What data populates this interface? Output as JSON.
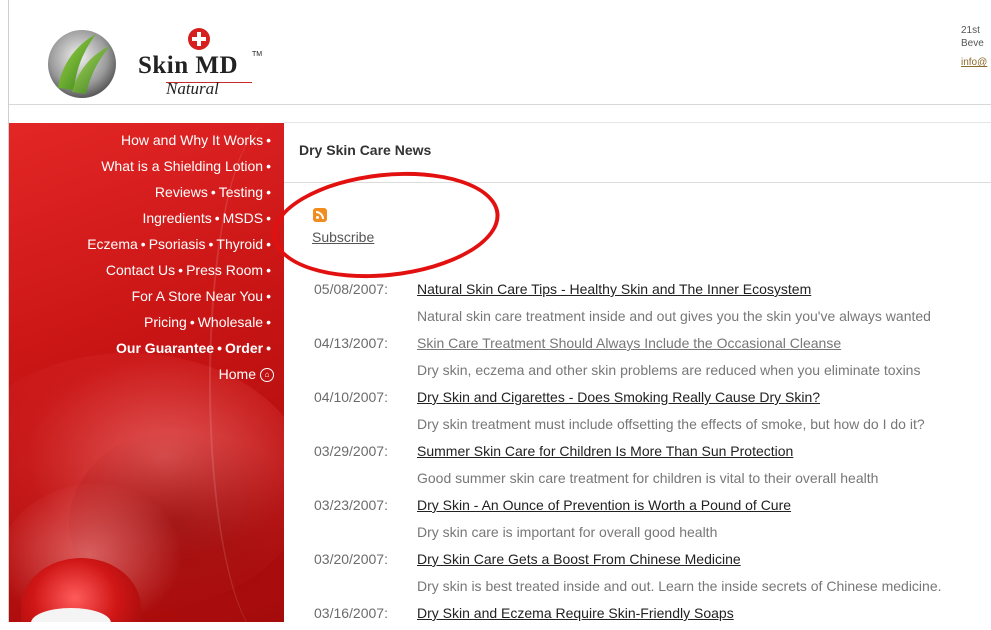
{
  "header": {
    "logo": {
      "brand": "Skin MD",
      "tm": "TM",
      "tagline": "Natural"
    },
    "contact": {
      "line1": "21st",
      "line2": "Beve",
      "email": "info@"
    }
  },
  "sidebar": {
    "nav": [
      {
        "items": [
          "How and Why It Works"
        ],
        "trailing_bullet": true,
        "bold": false
      },
      {
        "items": [
          "What is a Shielding Lotion"
        ],
        "trailing_bullet": true,
        "bold": false
      },
      {
        "items": [
          "Reviews",
          "Testing"
        ],
        "trailing_bullet": true,
        "bold": false
      },
      {
        "items": [
          "Ingredients",
          "MSDS"
        ],
        "trailing_bullet": true,
        "bold": false
      },
      {
        "items": [
          "Eczema",
          "Psoriasis",
          "Thyroid"
        ],
        "trailing_bullet": true,
        "bold": false
      },
      {
        "items": [
          "Contact Us",
          "Press Room"
        ],
        "trailing_bullet": true,
        "bold": false
      },
      {
        "items": [
          "For A Store Near You"
        ],
        "trailing_bullet": true,
        "bold": false
      },
      {
        "items": [
          "Pricing",
          "Wholesale"
        ],
        "trailing_bullet": true,
        "bold": false
      },
      {
        "items": [
          "Our Guarantee",
          "Order"
        ],
        "trailing_bullet": true,
        "bold": true
      },
      {
        "items": [
          "Home"
        ],
        "trailing_bullet": false,
        "bold": false,
        "icon": "home-icon"
      }
    ]
  },
  "content": {
    "title": "Dry Skin Care News",
    "rss_icon": "rss-icon",
    "subscribe_label": "Subscribe",
    "annotation_color": "#e31010",
    "news": [
      {
        "date": "05/08/2007:",
        "title": "Natural Skin Care Tips - Healthy Skin and The Inner Ecosystem",
        "visited": false,
        "description": "Natural skin care treatment inside and out gives you the skin you've always wanted"
      },
      {
        "date": "04/13/2007:",
        "title": "Skin Care Treatment Should Always Include the Occasional Cleanse",
        "visited": true,
        "description": "Dry skin, eczema and other skin problems are reduced when you eliminate toxins"
      },
      {
        "date": "04/10/2007:",
        "title": "Dry Skin and Cigarettes - Does Smoking Really Cause Dry Skin?",
        "visited": false,
        "description": "Dry skin treatment must include offsetting the effects of smoke, but how do I do it?"
      },
      {
        "date": "03/29/2007:",
        "title": "Summer Skin Care for Children Is More Than Sun Protection",
        "visited": false,
        "description": "Good summer skin care treatment for children is vital to their overall health"
      },
      {
        "date": "03/23/2007:",
        "title": "Dry Skin - An Ounce of Prevention is Worth a Pound of Cure",
        "visited": false,
        "description": "Dry skin care is important for overall good health"
      },
      {
        "date": "03/20/2007:",
        "title": "Dry Skin Care Gets a Boost From Chinese Medicine",
        "visited": false,
        "description": "Dry skin is best treated inside and out. Learn the inside secrets of Chinese medicine."
      },
      {
        "date": "03/16/2007:",
        "title": "Dry Skin and Eczema Require Skin-Friendly Soaps",
        "visited": false,
        "description": ""
      }
    ]
  }
}
